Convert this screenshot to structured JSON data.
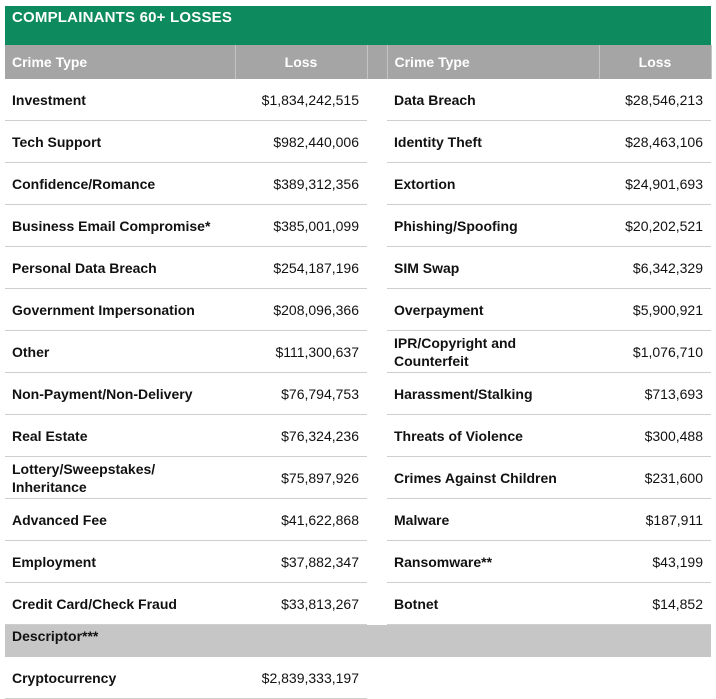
{
  "title": "COMPLAINANTS 60+ LOSSES",
  "headers": {
    "crime_type": "Crime Type",
    "loss": "Loss"
  },
  "rows": [
    {
      "left_crime": "Investment",
      "left_loss": "$1,834,242,515",
      "right_crime": "Data Breach",
      "right_loss": "$28,546,213"
    },
    {
      "left_crime": "Tech Support",
      "left_loss": "$982,440,006",
      "right_crime": "Identity Theft",
      "right_loss": "$28,463,106"
    },
    {
      "left_crime": "Confidence/Romance",
      "left_loss": "$389,312,356",
      "right_crime": "Extortion",
      "right_loss": "$24,901,693"
    },
    {
      "left_crime": "Business Email Compromise*",
      "left_loss": "$385,001,099",
      "right_crime": "Phishing/Spoofing",
      "right_loss": "$20,202,521"
    },
    {
      "left_crime": "Personal Data Breach",
      "left_loss": "$254,187,196",
      "right_crime": "SIM Swap",
      "right_loss": "$6,342,329"
    },
    {
      "left_crime": "Government Impersonation",
      "left_loss": "$208,096,366",
      "right_crime": "Overpayment",
      "right_loss": "$5,900,921"
    },
    {
      "left_crime": "Other",
      "left_loss": "$111,300,637",
      "right_crime": "IPR/Copyright and Counterfeit",
      "right_loss": "$1,076,710"
    },
    {
      "left_crime": "Non-Payment/Non-Delivery",
      "left_loss": "$76,794,753",
      "right_crime": "Harassment/Stalking",
      "right_loss": "$713,693"
    },
    {
      "left_crime": "Real Estate",
      "left_loss": "$76,324,236",
      "right_crime": "Threats of Violence",
      "right_loss": "$300,488"
    },
    {
      "left_crime": "Lottery/Sweepstakes/ Inheritance",
      "left_loss": "$75,897,926",
      "right_crime": "Crimes Against Children",
      "right_loss": "$231,600"
    },
    {
      "left_crime": "Advanced Fee",
      "left_loss": "$41,622,868",
      "right_crime": "Malware",
      "right_loss": "$187,911"
    },
    {
      "left_crime": "Employment",
      "left_loss": "$37,882,347",
      "right_crime": "Ransomware**",
      "right_loss": "$43,199"
    },
    {
      "left_crime": "Credit Card/Check Fraud",
      "left_loss": "$33,813,267",
      "right_crime": "Botnet",
      "right_loss": "$14,852"
    }
  ],
  "descriptor": {
    "label": "Descriptor***",
    "crime": "Cryptocurrency",
    "loss": "$2,839,333,197"
  }
}
